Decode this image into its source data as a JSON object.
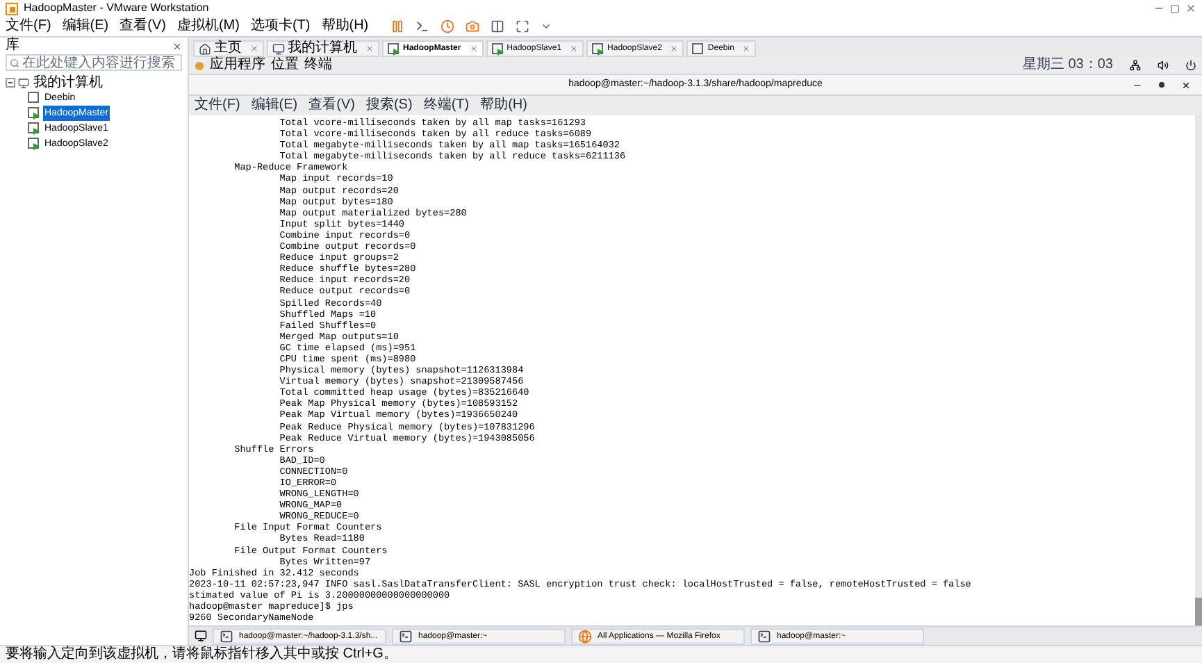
{
  "window": {
    "title": "HadoopMaster - VMware Workstation"
  },
  "menu": [
    "文件(F)",
    "编辑(E)",
    "查看(V)",
    "虚拟机(M)",
    "选项卡(T)",
    "帮助(H)"
  ],
  "library": {
    "title": "库",
    "search": {
      "placeholder": "在此处键入内容进行搜索"
    },
    "tree": [
      {
        "label": "我的计算机",
        "expanded": true,
        "selected": false,
        "children": [
          {
            "label": "Deebin",
            "selected": false
          },
          {
            "label": "HadoopMaster",
            "selected": true
          },
          {
            "label": "HadoopSlave1",
            "selected": false
          },
          {
            "label": "HadoopSlave2",
            "selected": false
          }
        ]
      }
    ]
  },
  "tabs": [
    {
      "label": "主页",
      "kind": "home",
      "selected": false
    },
    {
      "label": "我的计算机",
      "kind": "computer",
      "selected": false
    },
    {
      "label": "HadoopMaster",
      "kind": "vm",
      "selected": true
    },
    {
      "label": "HadoopSlave1",
      "kind": "vm",
      "selected": false
    },
    {
      "label": "HadoopSlave2",
      "kind": "vm",
      "selected": false
    },
    {
      "label": "Deebin",
      "kind": "vmoff",
      "selected": false
    }
  ],
  "gnome_bar": {
    "menus": [
      "应用程序",
      "位置",
      "终端"
    ],
    "clock": "星期三 03：03"
  },
  "terminal": {
    "title": "hadoop@master:~/hadoop-3.1.3/share/hadoop/mapreduce",
    "menu": [
      "文件(F)",
      "编辑(E)",
      "查看(V)",
      "搜索(S)",
      "终端(T)",
      "帮助(H)"
    ],
    "lines": [
      "                Total vcore-milliseconds taken by all map tasks=161293",
      "                Total vcore-milliseconds taken by all reduce tasks=6089",
      "                Total megabyte-milliseconds taken by all map tasks=165164032",
      "                Total megabyte-milliseconds taken by all reduce tasks=6211136",
      "        Map-Reduce Framework",
      "                Map input records=10",
      "                Map output records=20",
      "                Map output bytes=180",
      "                Map output materialized bytes=280",
      "                Input split bytes=1440",
      "                Combine input records=0",
      "                Combine output records=0",
      "                Reduce input groups=2",
      "                Reduce shuffle bytes=280",
      "                Reduce input records=20",
      "                Reduce output records=0",
      "                Spilled Records=40",
      "                Shuffled Maps =10",
      "                Failed Shuffles=0",
      "                Merged Map outputs=10",
      "                GC time elapsed (ms)=951",
      "                CPU time spent (ms)=8980",
      "                Physical memory (bytes) snapshot=1126313984",
      "                Virtual memory (bytes) snapshot=21309587456",
      "                Total committed heap usage (bytes)=835216640",
      "                Peak Map Physical memory (bytes)=108593152",
      "                Peak Map Virtual memory (bytes)=1936650240",
      "                Peak Reduce Physical memory (bytes)=107831296",
      "                Peak Reduce Virtual memory (bytes)=1943085056",
      "        Shuffle Errors",
      "                BAD_ID=0",
      "                CONNECTION=0",
      "                IO_ERROR=0",
      "                WRONG_LENGTH=0",
      "                WRONG_MAP=0",
      "                WRONG_REDUCE=0",
      "        File Input Format Counters",
      "                Bytes Read=1180",
      "        File Output Format Counters",
      "                Bytes Written=97",
      "Job Finished in 32.412 seconds",
      "2023-10-11 02:57:23,947 INFO sasl.SaslDataTransferClient: SASL encryption trust check: localHostTrusted = false, remoteHostTrusted = false",
      "stimated value of Pi is 3.20000000000000000000",
      "hadoop@master mapreduce]$ jps",
      "9260 SecondaryNameNode"
    ]
  },
  "taskbar": [
    {
      "label": "hadoop@master:~/hadoop-3.1.3/sh...",
      "kind": "terminal"
    },
    {
      "label": "hadoop@master:~",
      "kind": "terminal"
    },
    {
      "label": "All Applications — Mozilla Firefox",
      "kind": "browser"
    },
    {
      "label": "hadoop@master:~",
      "kind": "terminal"
    }
  ],
  "status_bar": "要将输入定向到该虚拟机，请将鼠标指针移入其中或按 Ctrl+G。"
}
